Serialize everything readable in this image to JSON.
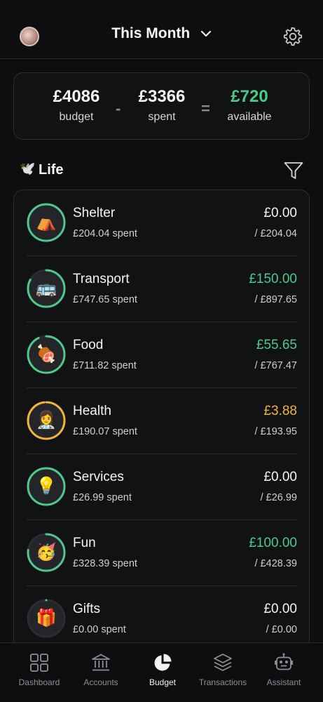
{
  "header": {
    "title": "This Month"
  },
  "summary": {
    "budget_value": "£4086",
    "budget_label": "budget",
    "minus": "-",
    "spent_value": "£3366",
    "spent_label": "spent",
    "equals": "=",
    "available_value": "£720",
    "available_label": "available"
  },
  "section": {
    "emoji": "🕊️",
    "title": "Life"
  },
  "categories": [
    {
      "name": "Shelter",
      "emoji": "⛺",
      "spent": "£204.04 spent",
      "available": "£0.00",
      "budget": "/ £204.04",
      "progress": 1.0,
      "status": "neutral"
    },
    {
      "name": "Transport",
      "emoji": "🚌",
      "spent": "£747.65 spent",
      "available": "£150.00",
      "budget": "/ £897.65",
      "progress": 0.83,
      "status": "green"
    },
    {
      "name": "Food",
      "emoji": "🍖",
      "spent": "£711.82 spent",
      "available": "£55.65",
      "budget": "/ £767.47",
      "progress": 0.93,
      "status": "green"
    },
    {
      "name": "Health",
      "emoji": "👩‍⚕️",
      "spent": "£190.07 spent",
      "available": "£3.88",
      "budget": "/ £193.95",
      "progress": 0.98,
      "status": "amber"
    },
    {
      "name": "Services",
      "emoji": "💡",
      "spent": "£26.99 spent",
      "available": "£0.00",
      "budget": "/ £26.99",
      "progress": 1.0,
      "status": "neutral"
    },
    {
      "name": "Fun",
      "emoji": "🥳",
      "spent": "£328.39 spent",
      "available": "£100.00",
      "budget": "/ £428.39",
      "progress": 0.77,
      "status": "green"
    },
    {
      "name": "Gifts",
      "emoji": "🎁",
      "spent": "£0.00 spent",
      "available": "£0.00",
      "budget": "/ £0.00",
      "progress": 0.0,
      "status": "neutral"
    }
  ],
  "tabs": [
    {
      "label": "Dashboard",
      "icon": "dashboard-grid-icon"
    },
    {
      "label": "Accounts",
      "icon": "bank-icon"
    },
    {
      "label": "Budget",
      "icon": "pie-chart-icon",
      "active": true
    },
    {
      "label": "Transactions",
      "icon": "layers-icon"
    },
    {
      "label": "Assistant",
      "icon": "robot-icon"
    }
  ],
  "colors": {
    "green": "#4fc98a",
    "amber": "#f2b33d",
    "ring_track": "#2b2d31",
    "ring_full": "#4fc98a"
  }
}
